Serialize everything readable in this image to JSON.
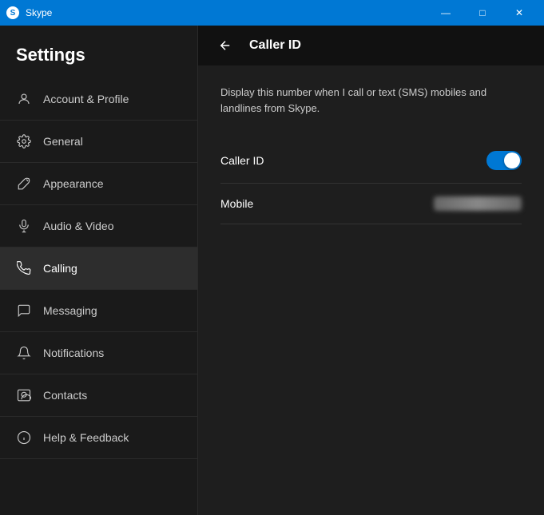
{
  "titlebar": {
    "icon": "S",
    "title": "Skype",
    "minimize_label": "—",
    "maximize_label": "□",
    "close_label": "✕"
  },
  "sidebar": {
    "title": "Settings",
    "items": [
      {
        "id": "account",
        "label": "Account & Profile",
        "icon": "person"
      },
      {
        "id": "general",
        "label": "General",
        "icon": "gear"
      },
      {
        "id": "appearance",
        "label": "Appearance",
        "icon": "brush"
      },
      {
        "id": "audio-video",
        "label": "Audio & Video",
        "icon": "mic"
      },
      {
        "id": "calling",
        "label": "Calling",
        "icon": "phone",
        "active": true
      },
      {
        "id": "messaging",
        "label": "Messaging",
        "icon": "chat"
      },
      {
        "id": "notifications",
        "label": "Notifications",
        "icon": "bell"
      },
      {
        "id": "contacts",
        "label": "Contacts",
        "icon": "contacts"
      },
      {
        "id": "help",
        "label": "Help & Feedback",
        "icon": "info"
      }
    ]
  },
  "content": {
    "title": "Caller ID",
    "description": "Display this number when I call or text (SMS) mobiles and landlines from Skype.",
    "settings": [
      {
        "id": "caller-id",
        "label": "Caller ID",
        "type": "toggle",
        "value": true
      },
      {
        "id": "mobile",
        "label": "Mobile",
        "type": "blurred",
        "value": "**********"
      }
    ]
  }
}
